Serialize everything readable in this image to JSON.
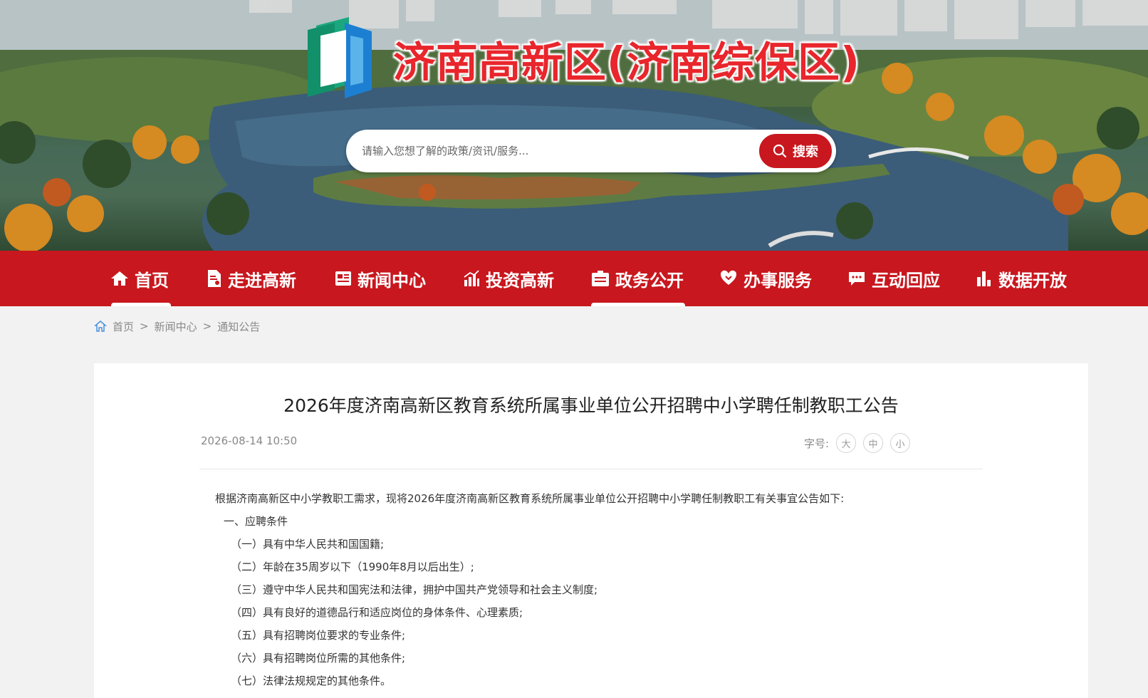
{
  "site": {
    "title": "济南高新区(济南综保区)",
    "logo_icon": "site-logo-icon"
  },
  "search": {
    "placeholder": "请输入您想了解的政策/资讯/服务...",
    "button_label": "搜索",
    "button_color": "#c8171e"
  },
  "nav": {
    "background": "#c8171e",
    "items": [
      {
        "label": "首页",
        "icon": "home-icon"
      },
      {
        "label": "走进高新",
        "icon": "document-icon"
      },
      {
        "label": "新闻中心",
        "icon": "news-icon"
      },
      {
        "label": "投资高新",
        "icon": "investment-icon"
      },
      {
        "label": "政务公开",
        "icon": "gov-affairs-icon"
      },
      {
        "label": "办事服务",
        "icon": "service-icon"
      },
      {
        "label": "互动回应",
        "icon": "chat-icon"
      },
      {
        "label": "数据开放",
        "icon": "data-icon"
      }
    ]
  },
  "breadcrumb": {
    "items": [
      "首页",
      "新闻中心",
      "通知公告"
    ],
    "separator": ">"
  },
  "article": {
    "title": "2026年度济南高新区教育系统所属事业单位公开招聘中小学聘任制教职工公告",
    "date": "2026-08-14 10:50",
    "font_size_label": "字号:",
    "font_sizes": [
      "大",
      "中",
      "小"
    ],
    "lead": "根据济南高新区中小学教职工需求，现将2026年度济南高新区教育系统所属事业单位公开招聘中小学聘任制教职工有关事宜公告如下:",
    "section_1": "一、应聘条件",
    "conditions": [
      "（一）具有中华人民共和国国籍;",
      "（二）年龄在35周岁以下（1990年8月以后出生）;",
      "（三）遵守中华人民共和国宪法和法律，拥护中国共产党领导和社会主义制度;",
      "（四）具有良好的道德品行和适应岗位的身体条件、心理素质;",
      "（五）具有招聘岗位要求的专业条件;",
      "（六）具有招聘岗位所需的其他条件;",
      "（七）法律法规规定的其他条件。"
    ]
  }
}
